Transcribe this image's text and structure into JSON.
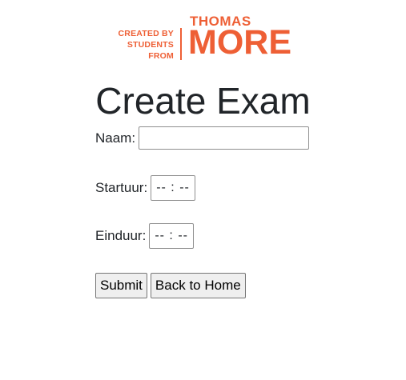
{
  "logo": {
    "left_lines": [
      "CREATED BY",
      "STUDENTS",
      "FROM"
    ],
    "top": "THOMAS",
    "main": "MORE",
    "color": "#ee5f35"
  },
  "page": {
    "title": "Create Exam"
  },
  "form": {
    "name_label": "Naam:",
    "name_value": "",
    "start_label": "Startuur:",
    "start_placeholder": "-- : --",
    "end_label": "Einduur:",
    "end_placeholder": "-- : --",
    "submit_label": "Submit",
    "back_label": "Back to Home"
  }
}
